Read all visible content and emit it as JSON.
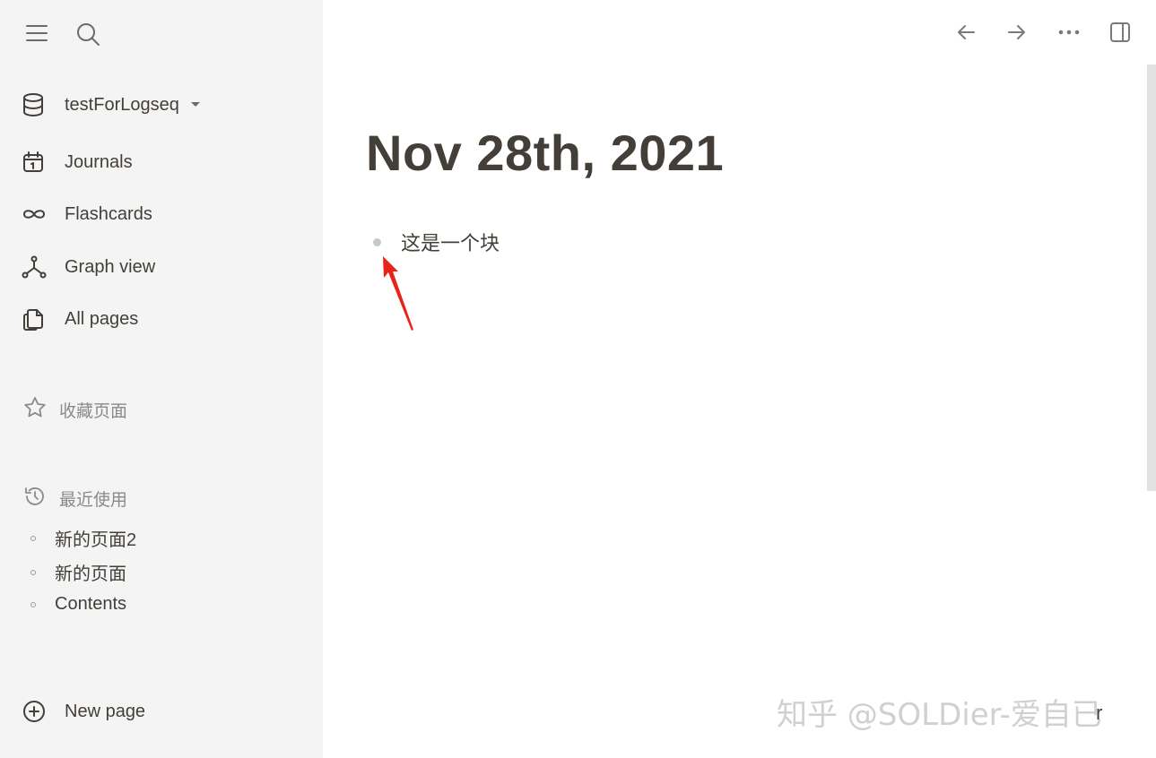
{
  "sidebar": {
    "repo_name": "testForLogseq",
    "nav": [
      {
        "label": "Journals",
        "icon": "calendar-icon"
      },
      {
        "label": "Flashcards",
        "icon": "infinity-icon"
      },
      {
        "label": "Graph view",
        "icon": "graph-icon"
      },
      {
        "label": "All pages",
        "icon": "pages-icon"
      }
    ],
    "favorites_title": "收藏页面",
    "recent_title": "最近使用",
    "recent_items": [
      "新的页面2",
      "新的页面",
      "Contents"
    ],
    "new_page_label": "New page"
  },
  "main": {
    "page_title": "Nov 28th, 2021",
    "blocks": [
      {
        "text": "这是一个块"
      }
    ]
  },
  "overlay": {
    "watermark": "知乎 @SOLDier-爱自已",
    "corner_glyph": "r"
  },
  "colors": {
    "sidebar_bg": "#f4f4f4",
    "text": "#433f38",
    "muted": "#8a8a8a",
    "arrow": "#e8231b"
  }
}
